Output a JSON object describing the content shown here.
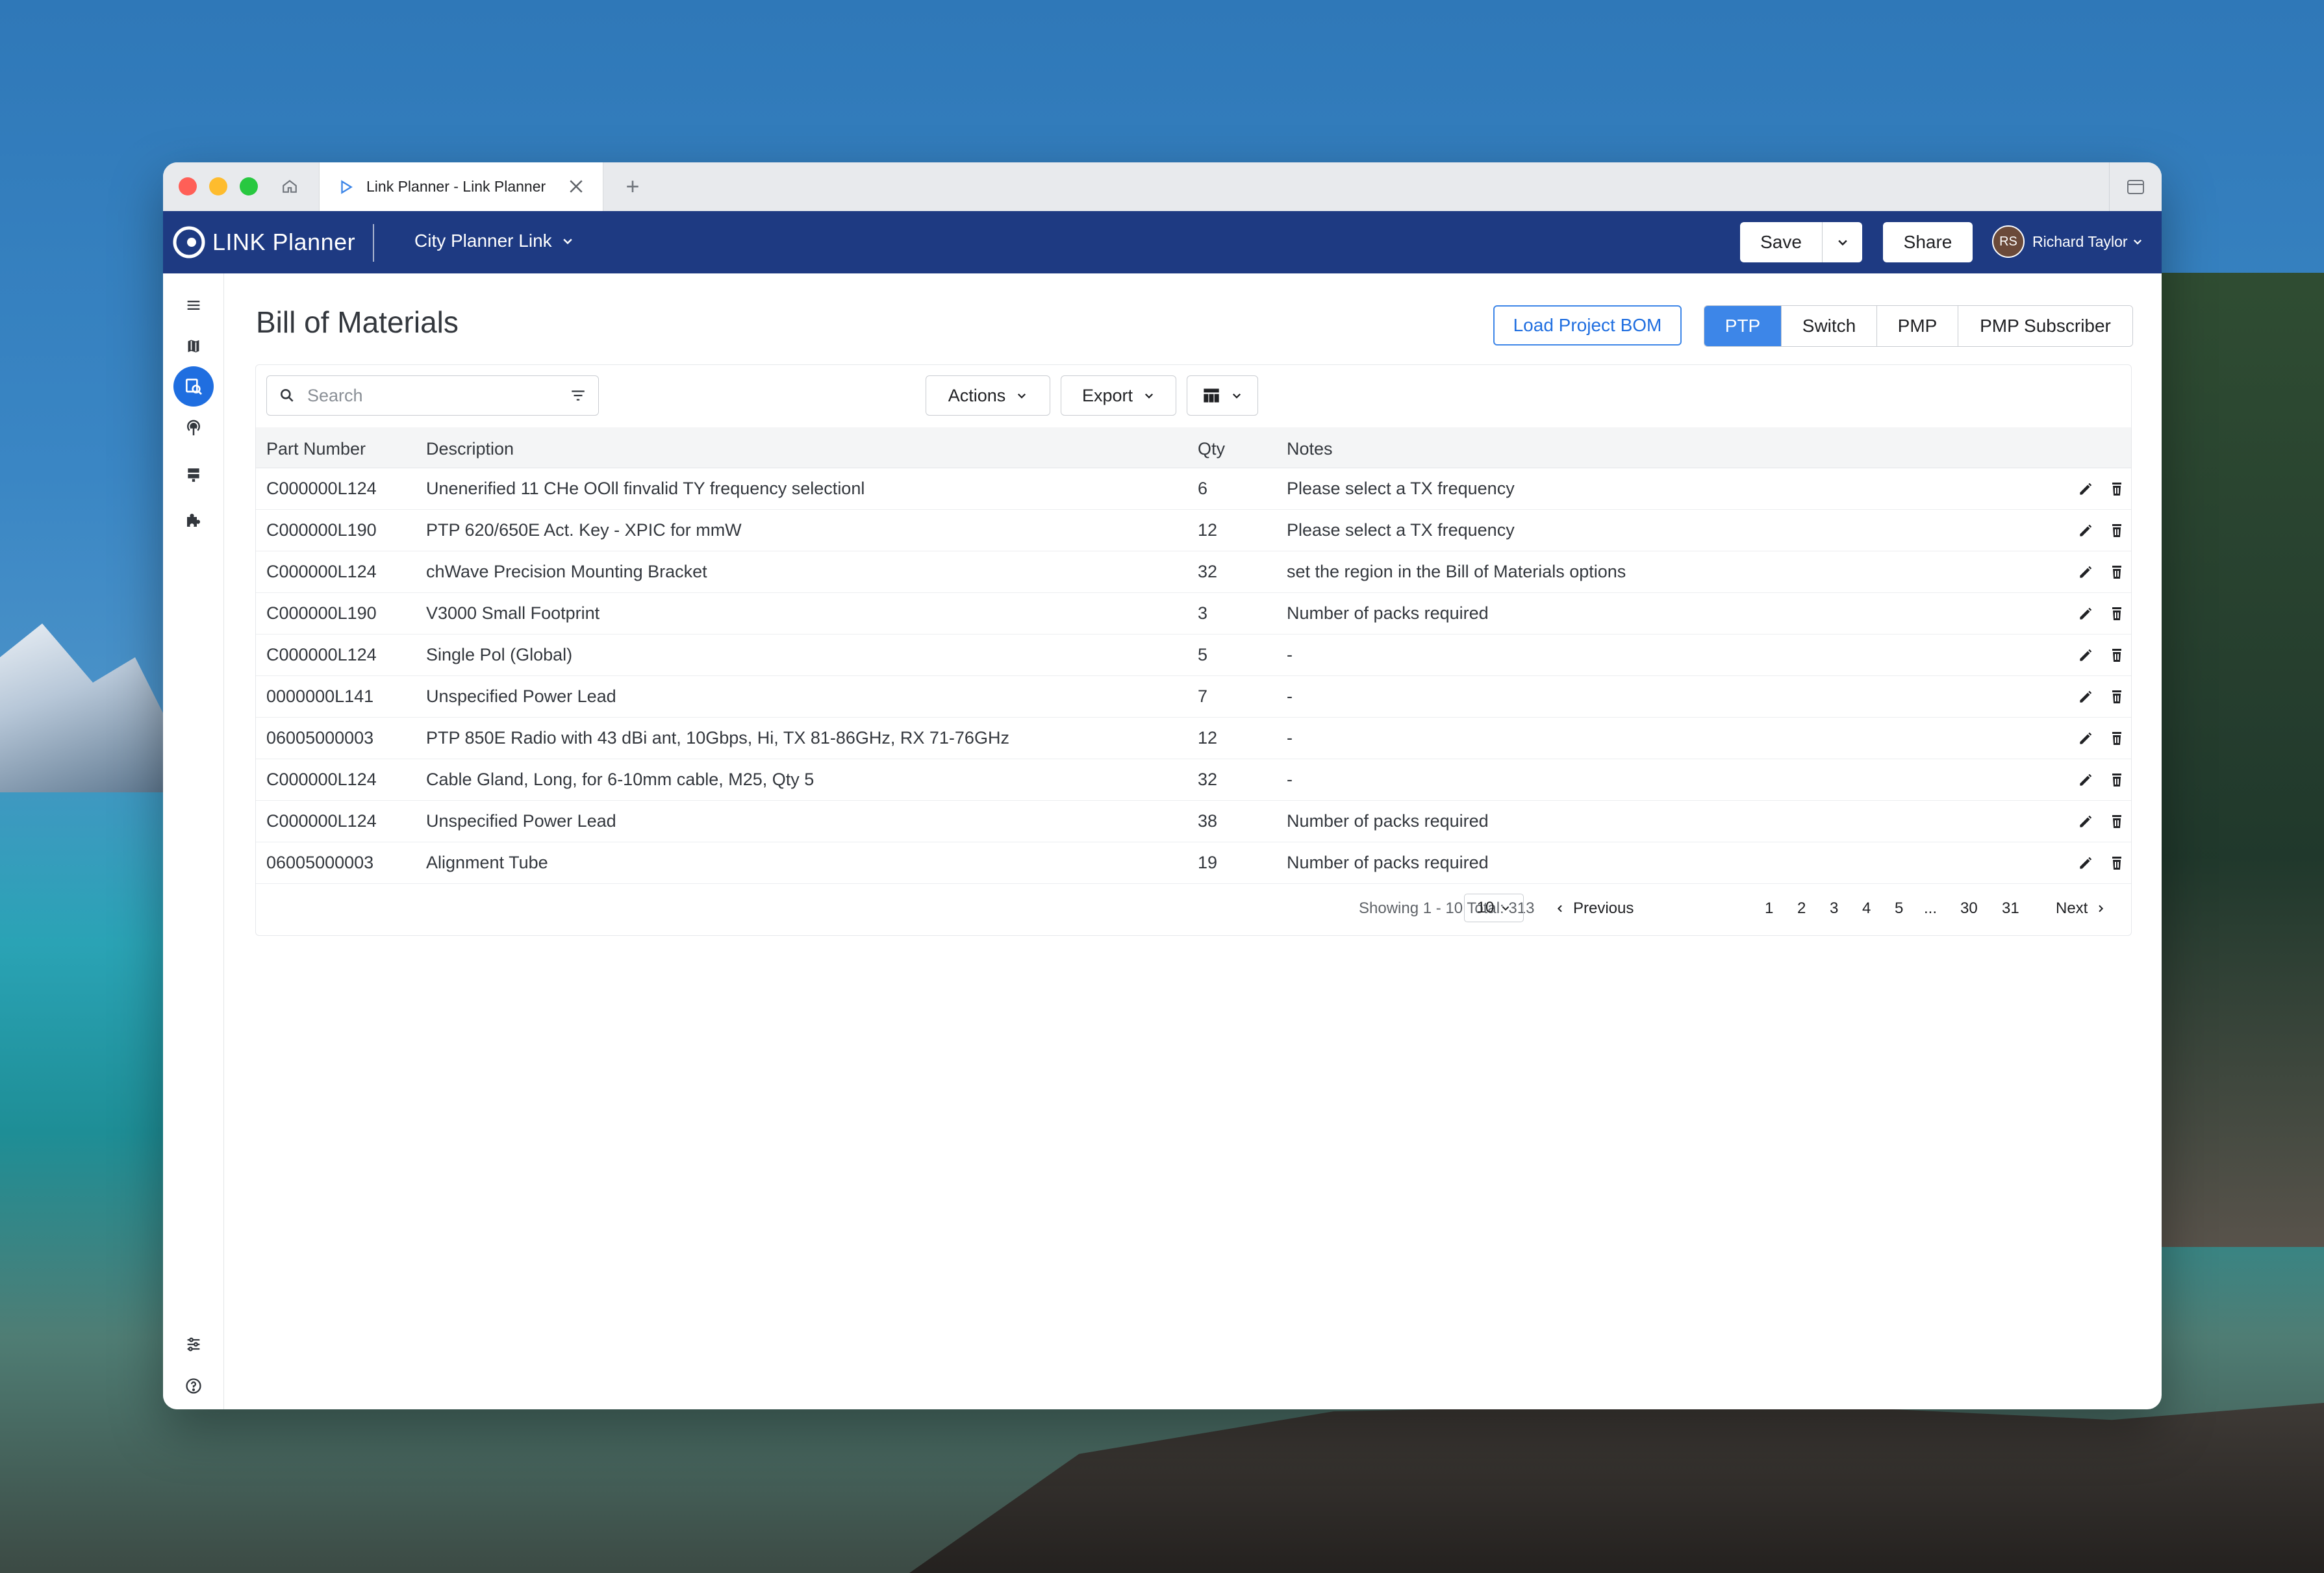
{
  "browser": {
    "tab_title": "Link Planner - Link Planner",
    "new_tab": "+"
  },
  "app": {
    "brand": "LINK Planner",
    "project_name": "City Planner Link",
    "save_label": "Save",
    "share_label": "Share",
    "user_initials": "RS",
    "user_name": "Richard Taylor",
    "brand_color": "#1e3a82",
    "accent_color": "#3d86e8"
  },
  "rail": {
    "items": [
      "menu-icon",
      "map-icon",
      "bom-icon",
      "antenna-icon",
      "server-icon",
      "puzzle-icon"
    ],
    "bottom": [
      "sliders-icon",
      "help-icon"
    ],
    "active": "bom-icon"
  },
  "page": {
    "title": "Bill of Materials",
    "load_bom": "Load Project BOM",
    "segments": [
      "PTP",
      "Switch",
      "PMP",
      "PMP Subscriber"
    ],
    "active_segment": "PTP"
  },
  "toolbar": {
    "search_placeholder": "Search",
    "actions": "Actions",
    "export": "Export"
  },
  "table": {
    "headers": [
      "Part Number",
      "Description",
      "Qty",
      "Notes"
    ],
    "rows": [
      [
        "C000000L124",
        "Unenerified 11 CHe OOll finvalid TY frequency selectionl",
        "6",
        "Please select a TX frequency"
      ],
      [
        "C000000L190",
        "PTP 620/650E Act. Key - XPIC for mmW",
        "12",
        "Please select a TX frequency"
      ],
      [
        "C000000L124",
        "chWave Precision Mounting Bracket",
        "32",
        "set the region in the Bill of Materials options"
      ],
      [
        "C000000L190",
        "V3000 Small Footprint",
        "3",
        "Number of packs required"
      ],
      [
        "C000000L124",
        "Single Pol (Global)",
        "5",
        "-"
      ],
      [
        "0000000L141",
        "Unspecified Power Lead",
        "7",
        "-"
      ],
      [
        "06005000003",
        "PTP 850E Radio with 43 dBi ant, 10Gbps, Hi, TX 81-86GHz, RX 71-76GHz",
        "12",
        "-"
      ],
      [
        "C000000L124",
        "Cable Gland, Long, for 6-10mm cable, M25, Qty 5",
        "32",
        "-"
      ],
      [
        "C000000L124",
        "Unspecified Power Lead",
        "38",
        "Number of packs required"
      ],
      [
        "06005000003",
        "Alignment Tube",
        "19",
        "Number of packs required"
      ]
    ]
  },
  "pagination": {
    "showing": "Showing 1 - 10 Total: 313",
    "per_page": "10",
    "previous": "Previous",
    "pages": [
      "1",
      "2",
      "3",
      "4",
      "5",
      "...",
      "30",
      "31"
    ],
    "next": "Next"
  }
}
